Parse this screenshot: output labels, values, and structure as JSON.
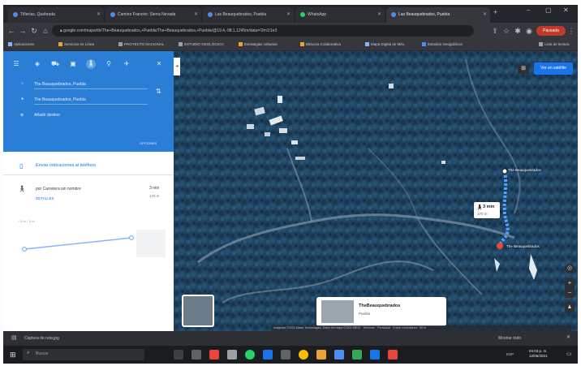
{
  "browser": {
    "tabs": [
      {
        "label": "Tiñerías, Quebrada"
      },
      {
        "label": "Camino Francés: Sierra Nevada"
      },
      {
        "label": "Las Beauquebrados, Puebla"
      },
      {
        "label": "WhatsApp"
      },
      {
        "label": "Las Beauquebrados, Puebla"
      }
    ],
    "new_tab": "+",
    "url": "google.com/maps/dir/The+Beauquebrados,+Puebla/The+Beauquebrados,+Puebla/@19.4,-98.1,1245m/data=!3m1!1e3",
    "profile_label": "Pausada",
    "bookmarks": [
      {
        "label": "Aplicaciones"
      },
      {
        "label": "Servicios en Línea"
      },
      {
        "label": "PROYECTO NACIONAL"
      },
      {
        "label": "ESTUDIO GEOLÓGICO"
      },
      {
        "label": "Estrategias Urbanas"
      },
      {
        "label": "Bitácora Colaborativa"
      },
      {
        "label": "Mapa Digital de Méx."
      },
      {
        "label": "Estudios Geográficos"
      }
    ],
    "reading_list": "Lista de lectura"
  },
  "sidebar": {
    "origin": "The Beauquebrados, Puebla",
    "destination": "The Beauquebrados, Puebla",
    "add_destination": "Añadir destino",
    "options": "OPCIONES",
    "send_to_phone": "Enviar indicaciones al teléfono",
    "route_via": "por Carretera sin nombre",
    "route_time": "3 min",
    "route_distance": "170 m",
    "details": "DETALLES",
    "elevation_label": "↑ 5 m  ↓ 5 m"
  },
  "map": {
    "layer_button": "Ver en satélite",
    "callout_time": "3 min",
    "callout_distance": "170 m",
    "label_start": "The Beauquebrados",
    "label_end": "The Beauquebrados",
    "place_card_title": "TheBeauquebrados",
    "place_card_sub": "Puebla",
    "attribution": "Imágenes ©2021 Maxar Technologies, Datos del mapa ©2021 INEGI · Términos · Privacidad · Enviar comentarios · 50 m"
  },
  "download": {
    "file": "Captura de ruta.jpg",
    "show_all": "Mostrar todo"
  },
  "taskbar": {
    "search_placeholder": "Buscar",
    "time": "04:03 p. m.",
    "date": "12/05/2021",
    "lang": "ESP"
  },
  "colors": {
    "accent": "#2a7ed6",
    "route": "#4fa3ff",
    "marker": "#e8453c"
  }
}
